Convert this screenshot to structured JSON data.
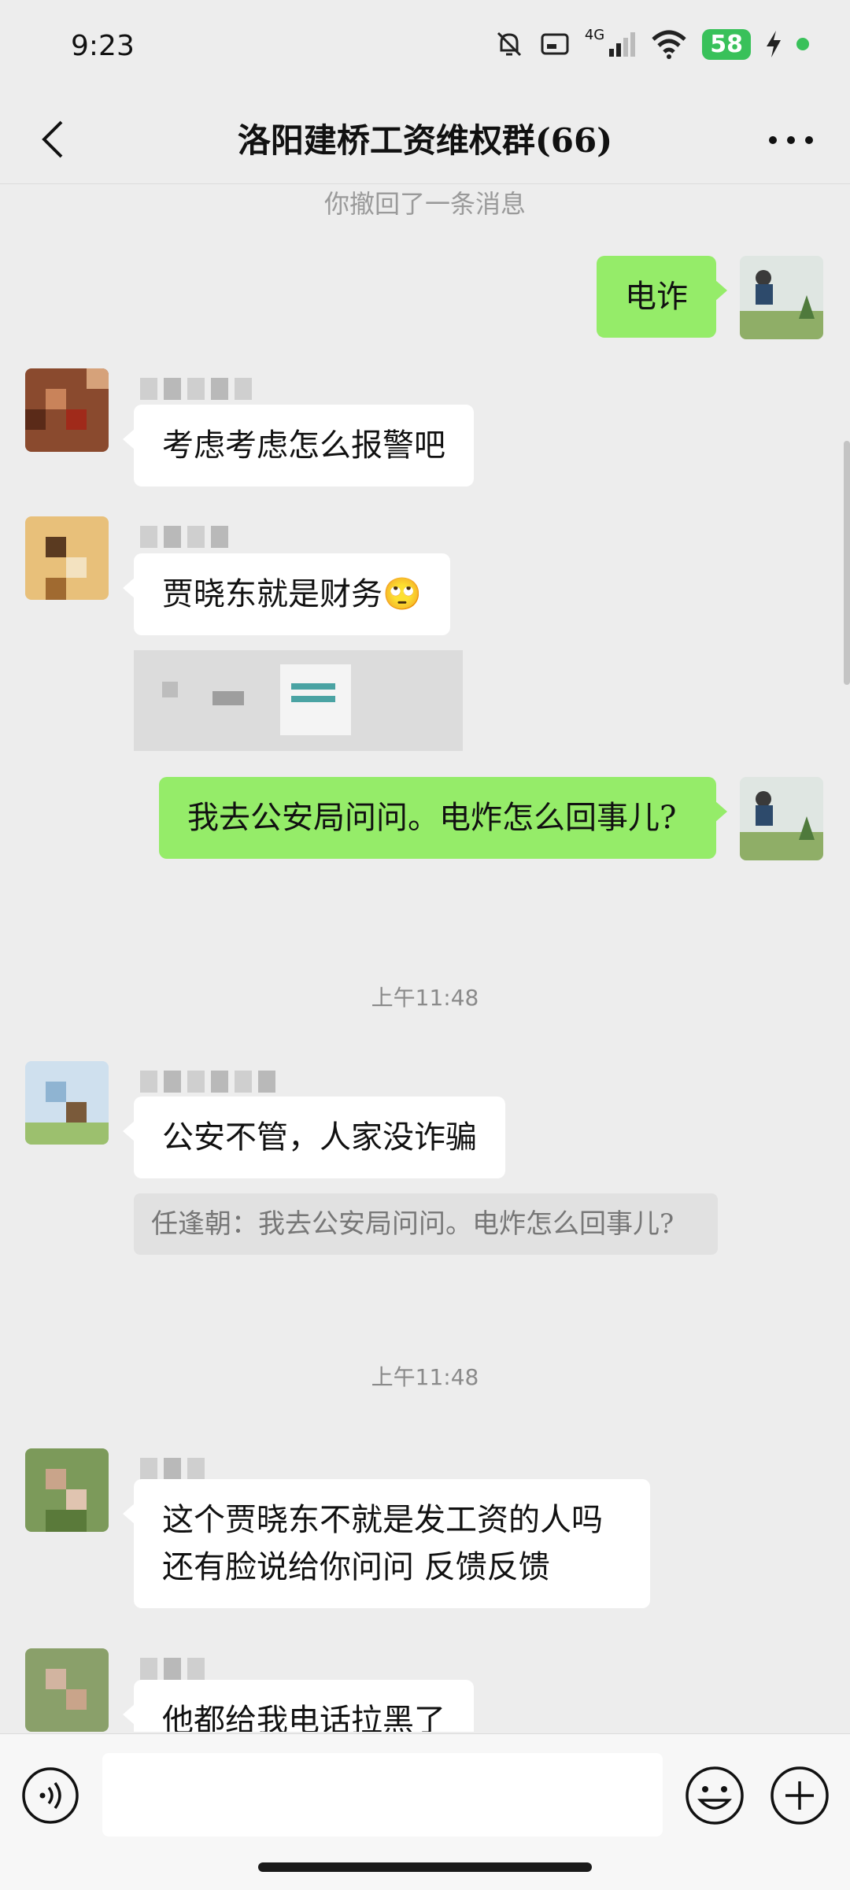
{
  "status_bar": {
    "time": "9:23",
    "network": "4G",
    "battery": "58",
    "icons": [
      "mute-bell-icon",
      "screen-icon",
      "signal-icon",
      "wifi-icon",
      "battery-icon",
      "charging-icon"
    ]
  },
  "header": {
    "title": "洛阳建桥工资维权群(66)",
    "back_icon": "chevron-left-icon",
    "more_icon": "more-dots-icon"
  },
  "messages": {
    "recalled_notice": "你撤回了一条消息",
    "m1_text": "电诈",
    "m2_text": "考虑考虑怎么报警吧",
    "m3_text": "贾晓东就是财务🙄",
    "m4_text": "我去公安局问问。电炸怎么回事儿?",
    "time1": "上午11:48",
    "m5_text": "公安不管，人家没诈骗",
    "m5_quote": "任逢朝：我去公安局问问。电炸怎么回事儿?",
    "time2": "上午11:48",
    "m6_text": "这个贾晓东不就是发工资的人吗还有脸说给你问问 反馈反馈",
    "m7_text": "他都给我电话拉黑了"
  },
  "input_bar": {
    "voice_icon": "voice-icon",
    "emoji_icon": "emoji-icon",
    "plus_icon": "plus-icon",
    "input_value": ""
  },
  "colors": {
    "background": "#ededed",
    "outgoing_bubble": "#95ec69",
    "incoming_bubble": "#ffffff",
    "battery": "#39c15a"
  }
}
